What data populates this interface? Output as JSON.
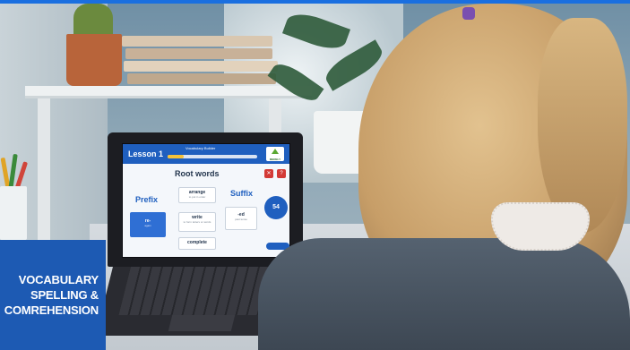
{
  "app": {
    "lesson_label": "Lesson 1",
    "module_title": "Vocabulary Builder",
    "progress": 0.18,
    "logo_text": "MERELY",
    "section_title": "Root words",
    "prefix_title": "Prefix",
    "suffix_title": "Suffix",
    "score": "54",
    "cards": {
      "prefix": {
        "word": "re-",
        "meaning": "again"
      },
      "root1": {
        "word": "arrange",
        "meaning": "to put in order"
      },
      "root2": {
        "word": "write",
        "meaning": "to form letters or words"
      },
      "root3": {
        "word": "complete",
        "meaning": ""
      },
      "suffix": {
        "word": "-ed",
        "meaning": "past tense"
      }
    }
  },
  "caption": {
    "line1": "VOCABULARY",
    "line2": "SPELLING &",
    "line3": "COMREHENSION"
  },
  "colors": {
    "accent": "#1f5fbf",
    "caption_bg": "#1d5ab3",
    "top_bar": "#1a6fe0",
    "tile_red": "#d33a36"
  }
}
